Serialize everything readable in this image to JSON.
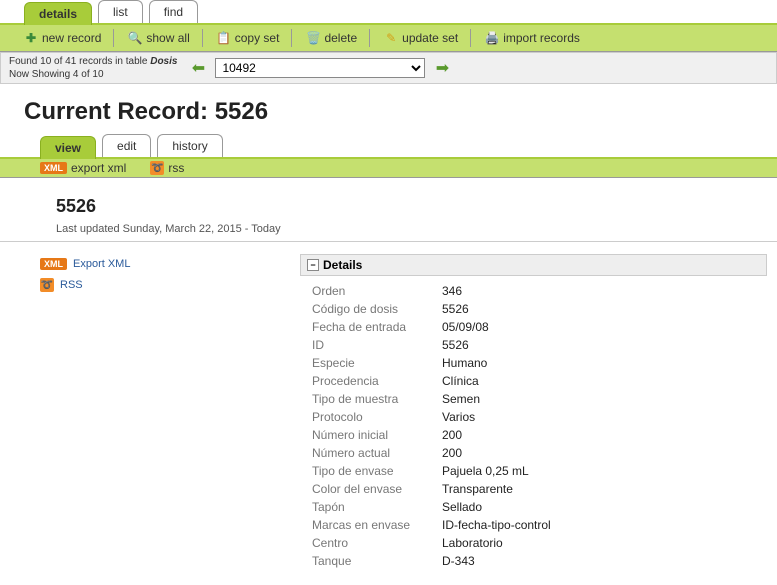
{
  "topTabs": {
    "details": "details",
    "list": "list",
    "find": "find"
  },
  "toolbar": {
    "newRecord": "new record",
    "showAll": "show all",
    "copySet": "copy set",
    "delete": "delete",
    "updateSet": "update set",
    "importRecords": "import records"
  },
  "nav": {
    "found_prefix": "Found ",
    "found_count": "10",
    "found_mid": " of 41 records in table ",
    "table": "Dosis",
    "showing_prefix": "Now Showing ",
    "showing": "4 of 10",
    "selectValue": "10492"
  },
  "pageTitle": {
    "prefix": "Current Record: ",
    "num": "5526"
  },
  "subTabs": {
    "view": "view",
    "edit": "edit",
    "history": "history"
  },
  "subToolbar": {
    "exportXml": "export xml",
    "rss": "rss"
  },
  "record": {
    "id": "5526",
    "lastUpdated": "Last updated Sunday, March 22, 2015 - Today"
  },
  "sideLinks": {
    "exportXml": "Export XML",
    "rss": "RSS"
  },
  "details": {
    "title": "Details",
    "fields": [
      {
        "label": "Orden",
        "value": "346"
      },
      {
        "label": "Código de dosis",
        "value": "5526"
      },
      {
        "label": "Fecha de entrada",
        "value": "05/09/08"
      },
      {
        "label": "ID",
        "value": "5526"
      },
      {
        "label": "Especie",
        "value": "Humano"
      },
      {
        "label": "Procedencia",
        "value": "Clínica"
      },
      {
        "label": "Tipo de muestra",
        "value": "Semen"
      },
      {
        "label": "Protocolo",
        "value": "Varios"
      },
      {
        "label": "Número inicial",
        "value": "200"
      },
      {
        "label": "Número actual",
        "value": "200"
      },
      {
        "label": "Tipo de envase",
        "value": "Pajuela 0,25 mL"
      },
      {
        "label": "Color del envase",
        "value": "Transparente"
      },
      {
        "label": "Tapón",
        "value": "Sellado"
      },
      {
        "label": "Marcas en envase",
        "value": "ID-fecha-tipo-control"
      },
      {
        "label": "Centro",
        "value": "Laboratorio"
      },
      {
        "label": "Tanque",
        "value": "D-343"
      }
    ]
  }
}
